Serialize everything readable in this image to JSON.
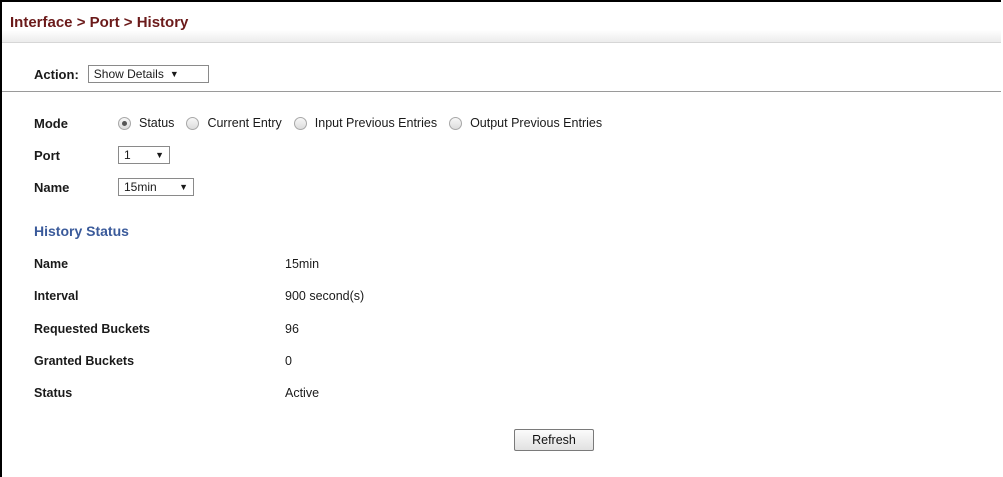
{
  "breadcrumb": "Interface > Port > History",
  "action": {
    "label": "Action:",
    "selected": "Show Details"
  },
  "form": {
    "mode_label": "Mode",
    "mode_options": [
      "Status",
      "Current Entry",
      "Input Previous Entries",
      "Output Previous Entries"
    ],
    "mode_selected": "Status",
    "port_label": "Port",
    "port_value": "1",
    "name_label": "Name",
    "name_value": "15min"
  },
  "history_status": {
    "title": "History Status",
    "rows": [
      {
        "key": "Name",
        "value": "15min"
      },
      {
        "key": "Interval",
        "value": "900 second(s)"
      },
      {
        "key": "Requested Buckets",
        "value": "96"
      },
      {
        "key": "Granted Buckets",
        "value": "0"
      },
      {
        "key": "Status",
        "value": "Active"
      }
    ]
  },
  "buttons": {
    "refresh": "Refresh"
  },
  "icons": {
    "dropdown": "chevron-down-icon",
    "radio": "radio-icon"
  },
  "colors": {
    "title": "#6b1a1a",
    "section_title": "#3a5a9a"
  }
}
